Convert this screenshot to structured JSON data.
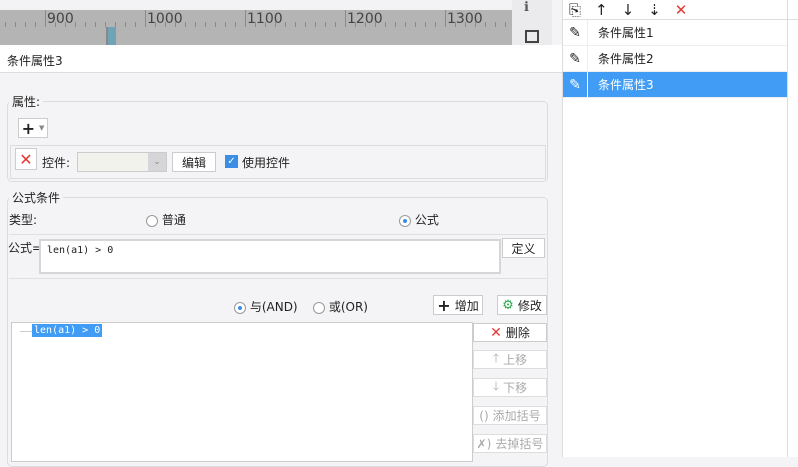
{
  "ruler": {
    "labels": [
      "900",
      "1000",
      "1100",
      "1200",
      "1300"
    ]
  },
  "title": "条件属性3",
  "attributes": {
    "label": "属性:",
    "add_icon": "plus-icon",
    "control_label": "控件:",
    "control_value": "",
    "edit_label": "编辑",
    "use_control_label": "使用控件",
    "use_control_checked": true
  },
  "formula_condition": {
    "label": "公式条件",
    "type_label": "类型:",
    "type_options": [
      "普通",
      "公式"
    ],
    "type_selected": "公式",
    "formula_label": "公式=",
    "formula_value": "len(a1) > 0",
    "define_label": "定义",
    "and_label": "与(AND)",
    "or_label": "或(OR)",
    "logic_selected": "AND",
    "add_label": "增加",
    "modify_label": "修改",
    "tree_items": [
      "len(a1) > 0"
    ],
    "side_buttons": {
      "delete": "删除",
      "move_up": "上移",
      "move_down": "下移",
      "add_bracket": "添加括号",
      "remove_bracket": "去掉括号"
    }
  },
  "conditions_list": {
    "items": [
      "条件属性1",
      "条件属性2",
      "条件属性3"
    ],
    "selected_index": 2
  },
  "colors": {
    "selection": "#419cf5",
    "delete": "#e53935"
  }
}
